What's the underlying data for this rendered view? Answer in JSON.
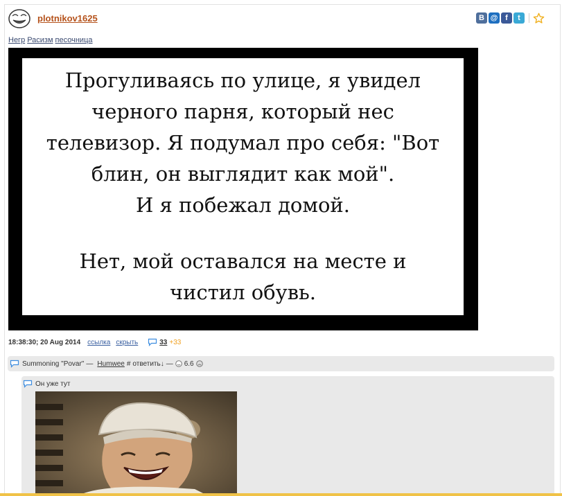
{
  "post": {
    "username": "plotnikov1625",
    "tags": [
      "Негр",
      "Расизм",
      "песочница"
    ],
    "image_text": [
      "Прогуливаясь по улице, я увидел",
      "черного парня, который нес",
      "телевизор. Я подумал про себя: \"Вот",
      "блин, он выглядит как мой\".",
      "И я побежал домой.",
      "",
      "Нет, мой оставался на месте и",
      "чистил обувь."
    ],
    "timestamp": "18:38:30; 20 Aug 2014",
    "link_label": "ссылка",
    "hide_label": "скрыть",
    "comments_count": "33",
    "comments_new": "+33"
  },
  "share": {
    "vk": "B",
    "mail": "@",
    "fb": "f",
    "tw": "t",
    "colors": {
      "vk": "#4f6f9c",
      "mail": "#1e6fc0",
      "fb": "#3b5998",
      "tw": "#3aa9d6",
      "star": "#f0b020"
    }
  },
  "comment": {
    "text": "Summoning \"Povar\"",
    "dash": "—",
    "author": "Humwee",
    "hash": "#",
    "reply_label": "ответить↓",
    "rating_dash": "—",
    "rating": "6.6"
  },
  "reply": {
    "text": "Он уже тут"
  },
  "icons": {
    "avatar": "troll-face-icon",
    "comment": "speech-bubble-icon",
    "smile": "smile-icon",
    "frown": "frown-icon",
    "favorite": "star-icon"
  }
}
